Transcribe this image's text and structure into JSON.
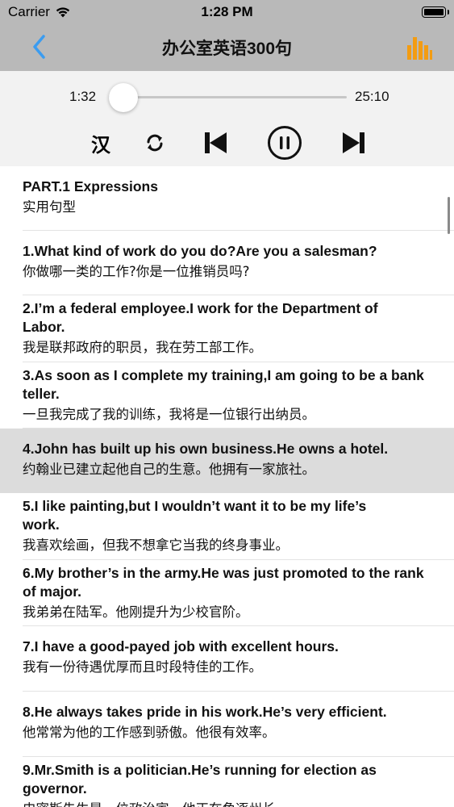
{
  "status": {
    "carrier": "Carrier",
    "time": "1:28 PM"
  },
  "nav": {
    "title": "办公室英语300句",
    "back_icon": "chevron-left-icon",
    "chart_icon": "bar-chart-icon",
    "back_color": "#3b9cf0",
    "chart_color": "#f39c12"
  },
  "player": {
    "current_time": "1:32",
    "total_time": "25:10",
    "progress": 0.06,
    "lang_label": "汉",
    "icons": [
      "repeat-icon",
      "skip-previous-icon",
      "pause-icon",
      "skip-next-icon"
    ],
    "accent": "#2e86de"
  },
  "items": [
    {
      "en": "PART.1 Expressions",
      "zh": "实用句型",
      "bold": true
    },
    {
      "en": "1.What kind of work do you do?Are you a salesman?",
      "zh": "你做哪一类的工作?你是一位推销员吗?"
    },
    {
      "en": "2.I’m a federal employee.I work for the Department of Labor.",
      "zh": "我是联邦政府的职员，我在劳工部工作。"
    },
    {
      "en": "3.As soon as I complete my training,I am going to be a bank teller.",
      "zh": "一旦我完成了我的训练，我将是一位银行出纳员。"
    },
    {
      "en": "4.John has built up his own business.He owns a hotel.",
      "zh": "约翰业已建立起他自己的生意。他拥有一家旅社。",
      "highlight": true
    },
    {
      "en": "5.I like painting,but I wouldn’t want it to be my life’s work.",
      "zh": "我喜欢绘画，但我不想拿它当我的终身事业。"
    },
    {
      "en": "6.My brother’s in the army.He was just promoted to the rank of major.",
      "zh": "我弟弟在陆军。他刚提升为少校官阶。"
    },
    {
      "en": "7.I have a good-payed job with excellent hours.",
      "zh": "我有一份待遇优厚而且时段特佳的工作。"
    },
    {
      "en": "8.He always takes pride in his work.He’s very efficient.",
      "zh": "他常常为他的工作感到骄傲。他很有效率。"
    },
    {
      "en": "9.Mr.Smith is a politician.He’s running for election as governor.",
      "zh": "史密斯先生是一位政治家。他正在角逐州长。"
    }
  ]
}
